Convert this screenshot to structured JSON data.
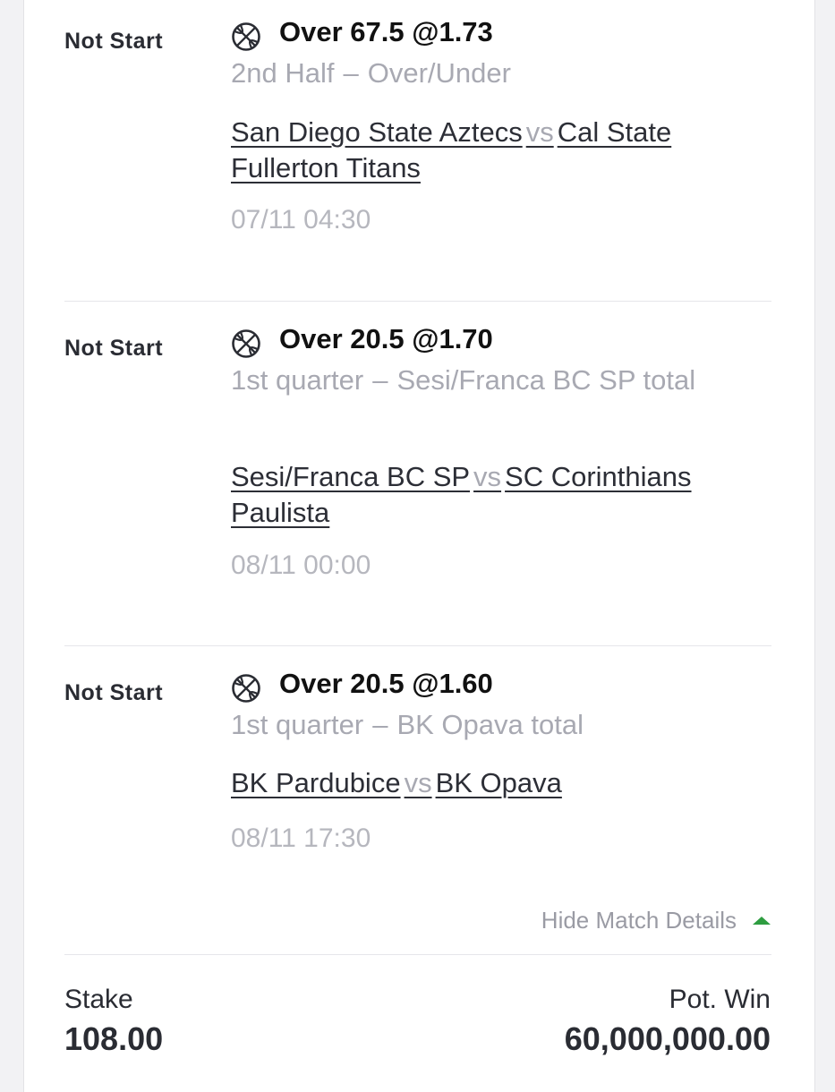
{
  "colors": {
    "accent_green": "#2e9d40",
    "muted_text": "#a8a9b2",
    "dark_text": "#2a2c33"
  },
  "bets": [
    {
      "status": "Not Start",
      "icon": "basketball-icon",
      "selection": "Over 67.5 @1.73",
      "market_period": "2nd Half",
      "market_sep": "–",
      "market_type": "Over/Under",
      "home": "San Diego State Aztecs",
      "vs": "vs",
      "away": "Cal State Fullerton Titans",
      "datetime": "07/11 04:30"
    },
    {
      "status": "Not Start",
      "icon": "basketball-icon",
      "selection": "Over 20.5 @1.70",
      "market_period": "1st quarter",
      "market_sep": "–",
      "market_type": "Sesi/Franca BC SP total",
      "home": "Sesi/Franca BC SP",
      "vs": "vs",
      "away": "SC Corinthians Paulista",
      "datetime": "08/11 00:00"
    },
    {
      "status": "Not Start",
      "icon": "basketball-icon",
      "selection": "Over 20.5 @1.60",
      "market_period": "1st quarter",
      "market_sep": "–",
      "market_type": "BK Opava total",
      "home": "BK Pardubice",
      "vs": "vs",
      "away": "BK Opava",
      "datetime": "08/11 17:30"
    }
  ],
  "details_toggle": {
    "label": "Hide Match Details",
    "icon": "chevron-up-icon"
  },
  "summary": {
    "stake_label": "Stake",
    "stake_value": "108.00",
    "win_label": "Pot. Win",
    "win_value": "60,000,000.00"
  }
}
